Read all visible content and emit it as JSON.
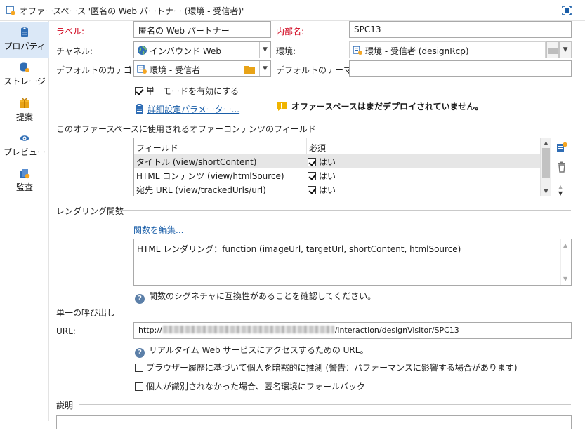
{
  "window": {
    "title": "オファースペース '匿名の Web パートナー (環境 - 受信者)'"
  },
  "sidebar": {
    "items": [
      {
        "label": "プロパティ",
        "icon": "properties-icon"
      },
      {
        "label": "ストレージ",
        "icon": "storage-icon"
      },
      {
        "label": "提案",
        "icon": "proposition-icon"
      },
      {
        "label": "プレビュー",
        "icon": "preview-icon"
      },
      {
        "label": "監査",
        "icon": "audit-icon"
      }
    ]
  },
  "form": {
    "label_caption": "ラベル:",
    "label_value": "匿名の Web パートナー",
    "internal_name_caption": "内部名:",
    "internal_name_value": "SPC13",
    "channel_caption": "チャネル:",
    "channel_value": "インバウンド Web",
    "environment_caption": "環境:",
    "environment_value": "環境 - 受信者 (designRcp)",
    "default_category_caption": "デフォルトのカテゴリ:",
    "default_category_value": "環境 - 受信者",
    "default_theme_caption": "デフォルトのテーマ:",
    "default_theme_value": "",
    "single_mode_label": "単一モードを有効にする",
    "single_mode_checked": true,
    "advanced_params_link": "詳細設定パラメーター...",
    "warning_text": "オファースペースはまだデプロイされていません。"
  },
  "fields_section": {
    "title": "このオファースペースに使用されるオファーコンテンツのフィールド",
    "columns": [
      "フィールド",
      "必須"
    ],
    "rows": [
      {
        "field": "タイトル (view/shortContent)",
        "required": "はい",
        "checked": true
      },
      {
        "field": "HTML コンテンツ (view/htmlSource)",
        "required": "はい",
        "checked": true
      },
      {
        "field": "宛先 URL (view/trackedUrls/url)",
        "required": "はい",
        "checked": true
      }
    ]
  },
  "rendering_section": {
    "title": "レンダリング関数",
    "edit_link": "関数を編集...",
    "function_text": "HTML レンダリング：function (imageUrl, targetUrl, shortContent, htmlSource)",
    "hint": "関数のシグネチャに互換性があることを確認してください。"
  },
  "single_call_section": {
    "title": "単一の呼び出し",
    "url_caption": "URL:",
    "url_prefix": "http://",
    "url_suffix": "/interaction/designVisitor/SPC13",
    "url_hint": "リアルタイム Web サービスにアクセスするための URL。",
    "option1": "ブラウザー履歴に基づいて個人を暗黙的に推測 (警告：パフォーマンスに影響する場合があります)",
    "option1_checked": false,
    "option2": "個人が識別されなかった場合、匿名環境にフォールバック",
    "option2_checked": false
  },
  "description_section": {
    "title": "説明"
  },
  "colors": {
    "accent": "#1a5ea8",
    "required_label": "#d0021b",
    "active_tab": "#dbe8f7"
  }
}
